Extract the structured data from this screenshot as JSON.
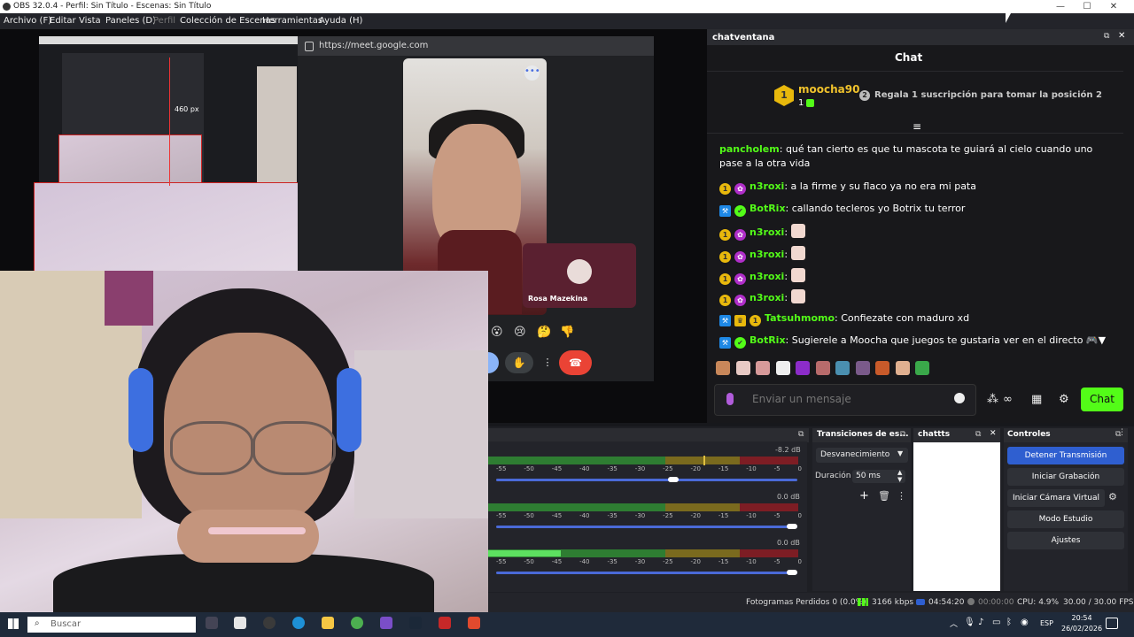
{
  "window": {
    "title": "OBS 32.0.4 - Perfil: Sin Título - Escenas: Sin Título",
    "minimize": "—",
    "maximize": "☐",
    "close": "✕"
  },
  "menu": [
    {
      "label": "Archivo (F)"
    },
    {
      "label": "Editar"
    },
    {
      "label": "Vista"
    },
    {
      "label": "Paneles (D)"
    },
    {
      "label": "Perfil"
    },
    {
      "label": "Colección de Escenas"
    },
    {
      "label": "Herramientas"
    },
    {
      "label": "Ayuda (H)"
    }
  ],
  "preview": {
    "measure_label": "460 px",
    "browser_url": "https://meet.google.com",
    "participant_name": "Rosa Mazekina",
    "reactions": [
      "😮",
      "😢",
      "🤔",
      "👎"
    ]
  },
  "chatwindow": {
    "title": "chatventana",
    "chat_header": "Chat",
    "leader": {
      "rank": "1",
      "name": "moocha90",
      "count": "1",
      "gift_rank": "2",
      "gift_text": "Regala 1 suscripción para tomar la posición 2"
    },
    "messages": [
      {
        "user": "pancholem",
        "color": "#53fc18",
        "text": "qué tan cierto es que tu mascota te guiará al cielo cuando uno pase a la otra vida",
        "badges": []
      },
      {
        "user": "n3roxi",
        "color": "#53fc18",
        "text": "a la firme y su flaco ya no era mi pata",
        "badges": [
          "1",
          "paw"
        ]
      },
      {
        "user": "BotRix",
        "color": "#53fc18",
        "text": "callando tecleros yo Botrix tu terror",
        "badges": [
          "bot",
          "verified"
        ]
      },
      {
        "user": "n3roxi",
        "color": "#53fc18",
        "text": "",
        "badges": [
          "1",
          "paw"
        ],
        "emote": true
      },
      {
        "user": "n3roxi",
        "color": "#53fc18",
        "text": "",
        "badges": [
          "1",
          "paw"
        ],
        "emote": true
      },
      {
        "user": "n3roxi",
        "color": "#53fc18",
        "text": "",
        "badges": [
          "1",
          "paw"
        ],
        "emote": true
      },
      {
        "user": "n3roxi",
        "color": "#53fc18",
        "text": "",
        "badges": [
          "1",
          "paw"
        ],
        "emote": true
      },
      {
        "user": "Tatsuhmomo",
        "color": "#53fc18",
        "text": "Confiezate con maduro xd",
        "badges": [
          "bot",
          "crown",
          "1"
        ]
      },
      {
        "user": "BotRix",
        "color": "#53fc18",
        "text": "Sugierele a Moocha que juegos te gustaria ver en el directo 🎮▼",
        "badges": [
          "bot",
          "verified"
        ]
      }
    ],
    "input_placeholder": "Enviar un mensaje",
    "send_label": "Chat"
  },
  "mixer": {
    "tracks": [
      {
        "db": "-8.2 dB",
        "level": 0.0
      },
      {
        "db": "0.0 dB",
        "level": 0.0
      },
      {
        "db": "0.0 dB",
        "level": 0.23
      }
    ],
    "scale": [
      "-55",
      "-50",
      "-45",
      "-40",
      "-35",
      "-30",
      "-25",
      "-20",
      "-15",
      "-10",
      "-5",
      "0"
    ]
  },
  "transitions": {
    "title": "Transiciones de es...",
    "selected": "Desvanecimiento",
    "duration_label": "Duración",
    "duration_value": "50 ms"
  },
  "chatts": {
    "title": "chattts"
  },
  "controls": {
    "title": "Controles",
    "buttons": [
      "Detener Transmisión",
      "Iniciar Grabación",
      "Iniciar Cámara Virtual",
      "Modo Estudio",
      "Ajustes"
    ]
  },
  "status": {
    "dropped": "Fotogramas Perdidos 0 (0.0%)",
    "bitrate": "3166 kbps",
    "stream_time": "04:54:20",
    "rec_time": "00:00:00",
    "cpu": "CPU: 4.9%",
    "fps": "30.00 / 30.00 FPS"
  },
  "taskbar": {
    "search_placeholder": "Buscar",
    "lang": "ESP",
    "time": "20:54",
    "date": "26/02/2026"
  },
  "colors": {
    "kick_green": "#53fc18",
    "obs_blue": "#2f5fd0",
    "end_call_red": "#ea4335",
    "leader_gold": "#f0c22c"
  }
}
